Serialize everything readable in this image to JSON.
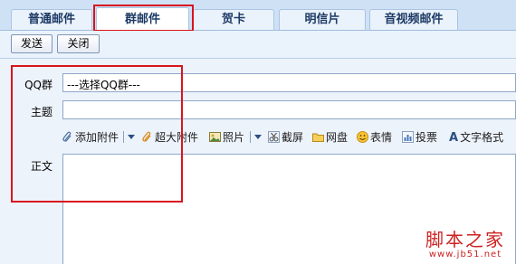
{
  "tabs": [
    {
      "label": "普通邮件",
      "active": false
    },
    {
      "label": "群邮件",
      "active": true
    },
    {
      "label": "贺卡",
      "active": false
    },
    {
      "label": "明信片",
      "active": false
    },
    {
      "label": "音视频邮件",
      "active": false
    }
  ],
  "toolbar": {
    "send_label": "发送",
    "close_label": "关闭"
  },
  "form": {
    "qq_group_label": "QQ群",
    "qq_group_value": "---选择QQ群---",
    "subject_label": "主题",
    "subject_value": "",
    "body_label": "正文",
    "body_value": ""
  },
  "attachments": {
    "add_attachment": "添加附件",
    "large_attachment": "超大附件",
    "photo": "照片",
    "screenshot": "截屏",
    "netdisk": "网盘",
    "emoji": "表情",
    "vote": "投票",
    "text_format": "文字格式"
  },
  "watermark": {
    "title": "脚本之家",
    "url": "www.jb51.net"
  },
  "colors": {
    "highlight": "#d9141e",
    "tab_text": "#1d3a66",
    "background": "#edf3fb"
  }
}
